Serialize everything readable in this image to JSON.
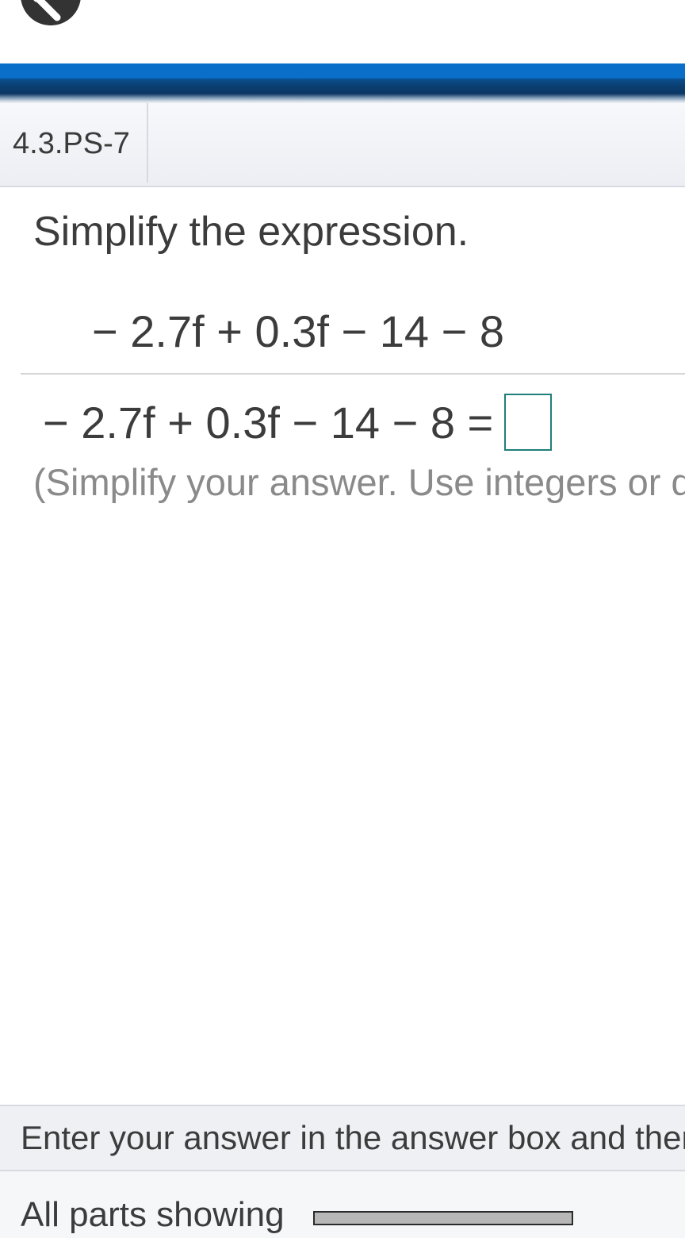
{
  "header": {
    "icon": "wrench-icon"
  },
  "problem": {
    "id": "4.3.PS-7",
    "instruction": "Simplify the expression.",
    "expression": "− 2.7f + 0.3f − 14 − 8",
    "answer_prompt": "− 2.7f + 0.3f − 14 − 8 =",
    "answer_value": "",
    "hint": "(Simplify your answer. Use integers or d"
  },
  "footer": {
    "instructions": "Enter your answer in the answer box and ther",
    "parts_label": "All parts showing",
    "progress": 1.0
  },
  "colors": {
    "banner_blue": "#0a6fc9",
    "answer_box_border": "#1f7f7a",
    "progress_fill": "#b7b7b7"
  }
}
